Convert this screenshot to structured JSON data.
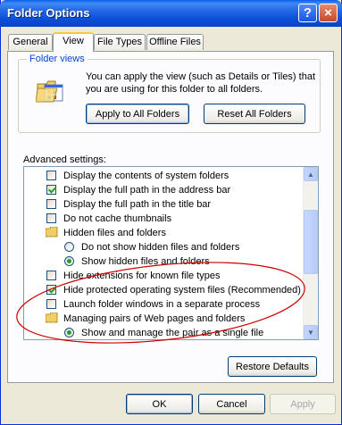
{
  "window": {
    "title": "Folder Options",
    "help_glyph": "?",
    "close_glyph": "×"
  },
  "tabs": [
    "General",
    "View",
    "File Types",
    "Offline Files"
  ],
  "active_tab": "View",
  "folder_views": {
    "label": "Folder views",
    "description": "You can apply the view (such as Details or Tiles) that you are using for this folder to all folders.",
    "apply_all": "Apply to All Folders",
    "reset_all": "Reset All Folders"
  },
  "advanced": {
    "label": "Advanced settings:",
    "items": [
      {
        "kind": "checkbox",
        "checked": false,
        "label": "Display the contents of system folders"
      },
      {
        "kind": "checkbox",
        "checked": true,
        "label": "Display the full path in the address bar"
      },
      {
        "kind": "checkbox",
        "checked": false,
        "label": "Display the full path in the title bar"
      },
      {
        "kind": "checkbox",
        "checked": false,
        "label": "Do not cache thumbnails"
      },
      {
        "kind": "folder",
        "label": "Hidden files and folders"
      },
      {
        "kind": "radio",
        "checked": false,
        "label": "Do not show hidden files and folders"
      },
      {
        "kind": "radio",
        "checked": true,
        "label": "Show hidden files and folders"
      },
      {
        "kind": "checkbox",
        "checked": false,
        "label": "Hide extensions for known file types"
      },
      {
        "kind": "checkbox",
        "checked": true,
        "label": "Hide protected operating system files (Recommended)"
      },
      {
        "kind": "checkbox",
        "checked": false,
        "label": "Launch folder windows in a separate process"
      },
      {
        "kind": "folder",
        "label": "Managing pairs of Web pages and folders"
      },
      {
        "kind": "radio",
        "checked": true,
        "label": "Show and manage the pair as a single file"
      }
    ],
    "restore_defaults": "Restore Defaults"
  },
  "footer": {
    "ok": "OK",
    "cancel": "Cancel",
    "apply": "Apply"
  },
  "colors": {
    "titlebar": "#0a50d8",
    "annotation": "#cc0000",
    "group_label": "#0046d5"
  }
}
